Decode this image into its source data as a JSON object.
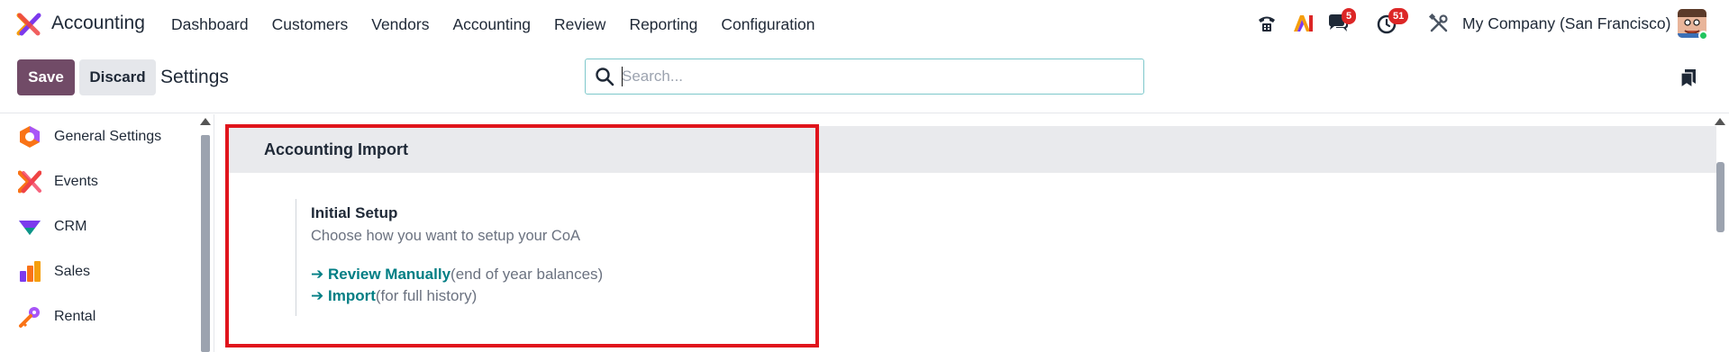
{
  "app": {
    "name": "Accounting"
  },
  "nav": {
    "items": [
      {
        "label": "Dashboard"
      },
      {
        "label": "Customers"
      },
      {
        "label": "Vendors"
      },
      {
        "label": "Accounting"
      },
      {
        "label": "Review"
      },
      {
        "label": "Reporting"
      },
      {
        "label": "Configuration"
      }
    ]
  },
  "systray": {
    "messages_count": "5",
    "activities_count": "51",
    "company": "My Company (San Francisco)"
  },
  "toolbar": {
    "save_label": "Save",
    "discard_label": "Discard",
    "breadcrumb": "Settings"
  },
  "search": {
    "placeholder": "Search...",
    "value": ""
  },
  "sidebar": {
    "items": [
      {
        "label": "General Settings",
        "icon": "general-settings-icon"
      },
      {
        "label": "Events",
        "icon": "events-icon"
      },
      {
        "label": "CRM",
        "icon": "crm-icon"
      },
      {
        "label": "Sales",
        "icon": "sales-icon"
      },
      {
        "label": "Rental",
        "icon": "rental-icon"
      }
    ]
  },
  "section": {
    "title": "Accounting Import",
    "setting": {
      "title": "Initial Setup",
      "description": "Choose how you want to setup your CoA",
      "links": [
        {
          "arrow": "➔",
          "label": "Review Manually",
          "note": "(end of year balances)"
        },
        {
          "arrow": "➔",
          "label": "Import",
          "note": "(for full history)"
        }
      ]
    }
  },
  "colors": {
    "brand": "#714b67",
    "link": "#017e84",
    "highlight": "#e0141c",
    "badge": "#dc2626"
  }
}
